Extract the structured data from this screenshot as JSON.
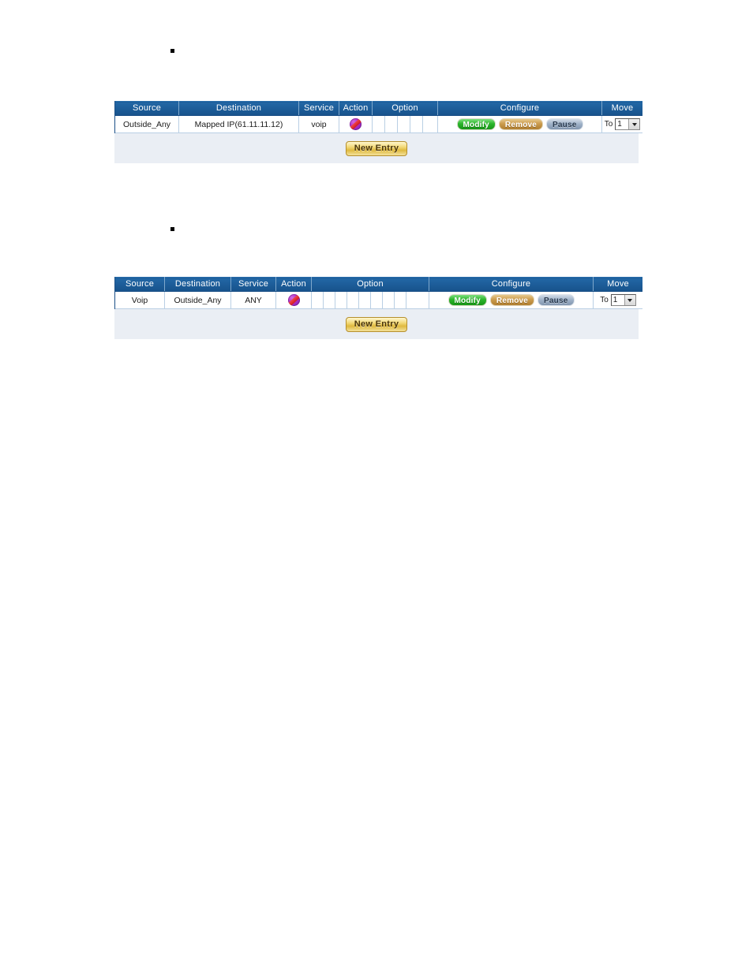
{
  "page": {
    "background_color": "#ffffff",
    "panel_background": "#eaeef4",
    "header_color": "#1b5a96"
  },
  "bullets": [
    {
      "name": "bullet-marker-1",
      "glyph": "square-bullet"
    },
    {
      "name": "bullet-marker-2",
      "glyph": "square-bullet"
    }
  ],
  "tables": [
    {
      "id": "policy-table-1",
      "columns": [
        "Source",
        "Destination",
        "Service",
        "Action",
        "Option",
        "Configure",
        "Move"
      ],
      "option_subcell_count": 5,
      "rows": [
        {
          "source": "Outside_Any",
          "destination": "Mapped IP(61.11.11.12)",
          "service": "voip",
          "action_icon": "permit-nat-icon",
          "option": [
            "",
            "",
            "",
            "",
            ""
          ],
          "configure": [
            {
              "label": "Modify",
              "style": "green"
            },
            {
              "label": "Remove",
              "style": "tan"
            },
            {
              "label": "Pause",
              "style": "blue"
            }
          ],
          "move": {
            "label": "To",
            "value": "1",
            "options": [
              "1"
            ]
          }
        }
      ],
      "new_entry_label": "New Entry"
    },
    {
      "id": "policy-table-2",
      "columns": [
        "Source",
        "Destination",
        "Service",
        "Action",
        "Option",
        "Configure",
        "Move"
      ],
      "option_subcell_count": 9,
      "rows": [
        {
          "source": "Voip",
          "destination": "Outside_Any",
          "service": "ANY",
          "action_icon": "permit-nat-icon",
          "option": [
            "",
            "",
            "",
            "",
            "",
            "",
            "",
            "",
            ""
          ],
          "configure": [
            {
              "label": "Modify",
              "style": "green"
            },
            {
              "label": "Remove",
              "style": "tan"
            },
            {
              "label": "Pause",
              "style": "blue"
            }
          ],
          "move": {
            "label": "To",
            "value": "1",
            "options": [
              "1"
            ]
          }
        }
      ],
      "new_entry_label": "New Entry"
    }
  ]
}
